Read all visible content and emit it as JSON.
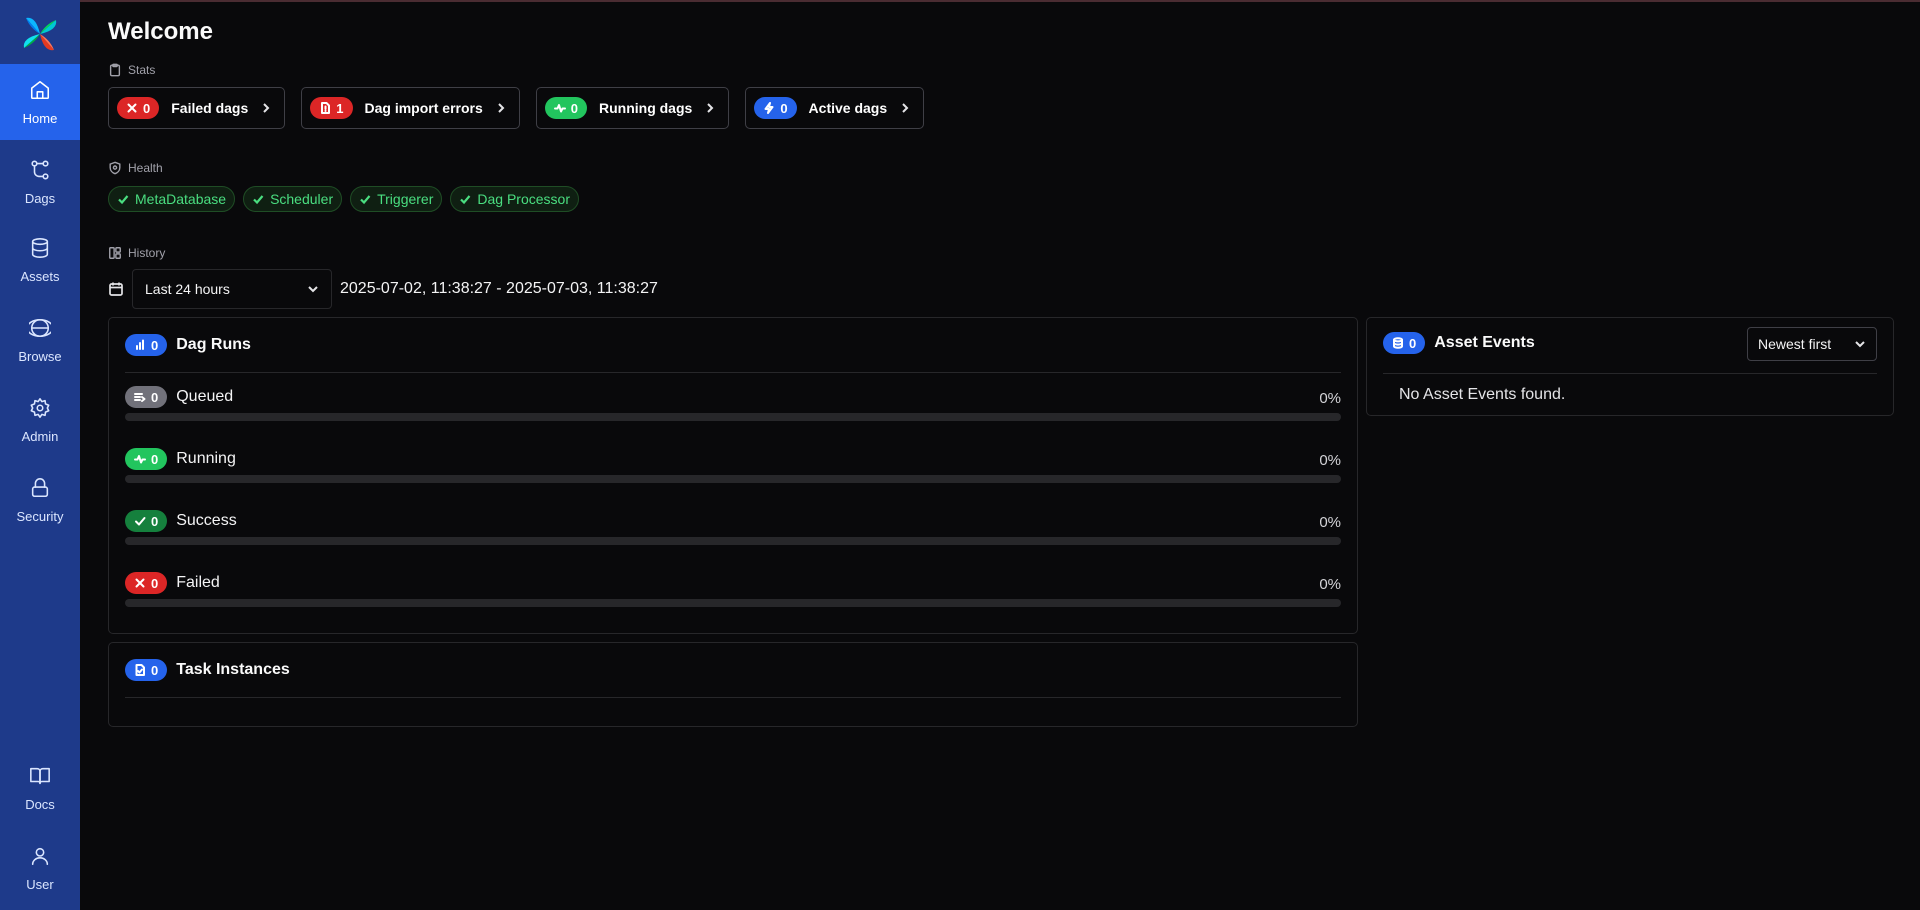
{
  "colors": {
    "sidebar": "#1e3a8a",
    "sidebar_active": "#2563eb",
    "failed": "#dc2626",
    "running": "#22c55e",
    "success": "#15803d",
    "queued": "#71717a",
    "blue": "#2563eb",
    "health_text": "#4ade80"
  },
  "sidebar": {
    "items": [
      {
        "label": "Home",
        "icon": "home-icon",
        "active": true
      },
      {
        "label": "Dags",
        "icon": "dags-icon"
      },
      {
        "label": "Assets",
        "icon": "database-icon"
      },
      {
        "label": "Browse",
        "icon": "globe-icon"
      },
      {
        "label": "Admin",
        "icon": "gear-icon"
      },
      {
        "label": "Security",
        "icon": "lock-icon"
      },
      {
        "label": "Docs",
        "icon": "book-icon"
      },
      {
        "label": "User",
        "icon": "user-icon"
      }
    ]
  },
  "page": {
    "title": "Welcome"
  },
  "stats": {
    "label": "Stats",
    "cards": [
      {
        "count": "0",
        "label": "Failed dags",
        "icon": "x-icon"
      },
      {
        "count": "1",
        "label": "Dag import errors",
        "icon": "file-alert-icon"
      },
      {
        "count": "0",
        "label": "Running dags",
        "icon": "activity-icon"
      },
      {
        "count": "0",
        "label": "Active dags",
        "icon": "zap-icon"
      }
    ]
  },
  "health": {
    "label": "Health",
    "items": [
      {
        "label": "MetaDatabase",
        "status": "healthy"
      },
      {
        "label": "Scheduler",
        "status": "healthy"
      },
      {
        "label": "Triggerer",
        "status": "healthy"
      },
      {
        "label": "Dag Processor",
        "status": "healthy"
      }
    ]
  },
  "history": {
    "label": "History",
    "range_select": "Last 24 hours",
    "date_range": "2025-07-02, 11:38:27 - 2025-07-03, 11:38:27",
    "dag_runs": {
      "title": "Dag Runs",
      "count": "0",
      "states": [
        {
          "name": "Queued",
          "count": "0",
          "percent": "0%",
          "fraction": 0
        },
        {
          "name": "Running",
          "count": "0",
          "percent": "0%",
          "fraction": 0
        },
        {
          "name": "Success",
          "count": "0",
          "percent": "0%",
          "fraction": 0
        },
        {
          "name": "Failed",
          "count": "0",
          "percent": "0%",
          "fraction": 0
        }
      ]
    },
    "task_instances": {
      "title": "Task Instances",
      "count": "0"
    }
  },
  "asset_events": {
    "title": "Asset Events",
    "count": "0",
    "sort": "Newest first",
    "empty_message": "No Asset Events found."
  }
}
